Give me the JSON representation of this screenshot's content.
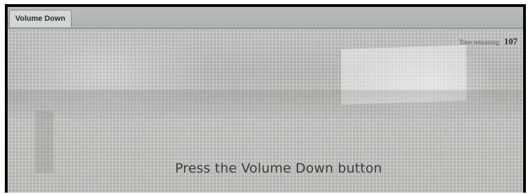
{
  "window": {
    "tab_label": "Volume Down"
  },
  "timer": {
    "label": "Time remaining:",
    "value": "107"
  },
  "instruction": {
    "text": "Press the Volume Down button"
  },
  "colors": {
    "header_bar": "#aeb1af",
    "tab_background": "#d4d6d3",
    "text_primary": "#3b3d40"
  }
}
